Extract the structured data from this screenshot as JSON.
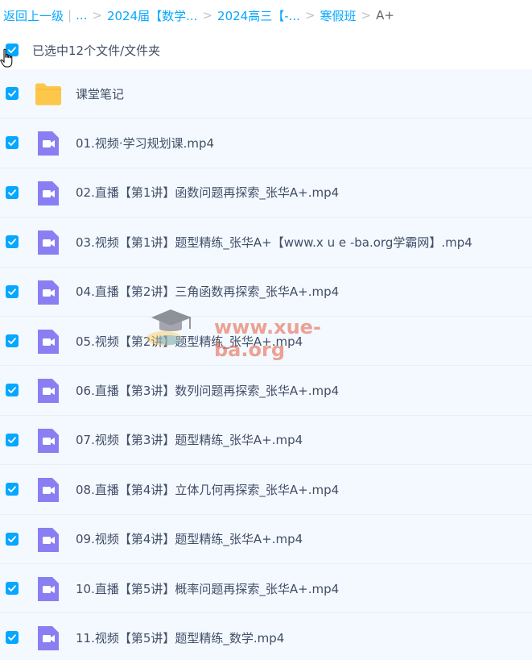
{
  "breadcrumb": {
    "back": "返回上一级",
    "ellipsis": "...",
    "crumbs": [
      "2024届【数学...",
      "2024高三【-...",
      "寒假班"
    ],
    "current": "A+",
    "sep": ">",
    "pipe": "|"
  },
  "selection": {
    "label": "已选中12个文件/文件夹"
  },
  "files": [
    {
      "name": "课堂笔记",
      "type": "folder"
    },
    {
      "name": "01.视频·学习规划课.mp4",
      "type": "video"
    },
    {
      "name": "02.直播【第1讲】函数问题再探索_张华A+.mp4",
      "type": "video"
    },
    {
      "name": "03.视频【第1讲】题型精练_张华A+【www.x u e -ba.org学霸网】.mp4",
      "type": "video"
    },
    {
      "name": "04.直播【第2讲】三角函数再探索_张华A+.mp4",
      "type": "video"
    },
    {
      "name": "05.视频【第2讲】题型精练_张华A+.mp4",
      "type": "video"
    },
    {
      "name": "06.直播【第3讲】数列问题再探索_张华A+.mp4",
      "type": "video"
    },
    {
      "name": "07.视频【第3讲】题型精练_张华A+.mp4",
      "type": "video"
    },
    {
      "name": "08.直播【第4讲】立体几何再探索_张华A+.mp4",
      "type": "video"
    },
    {
      "name": "09.视频【第4讲】题型精练_张华A+.mp4",
      "type": "video"
    },
    {
      "name": "10.直播【第5讲】概率问题再探索_张华A+.mp4",
      "type": "video"
    },
    {
      "name": "11.视频【第5讲】题型精练_数学.mp4",
      "type": "video"
    }
  ],
  "watermark": {
    "text": "www.xue-ba.org"
  },
  "colors": {
    "accent": "#06a7ff",
    "row_bg": "#f3f9ff",
    "folder": "#fcc74a",
    "video": "#8a7ff2"
  }
}
